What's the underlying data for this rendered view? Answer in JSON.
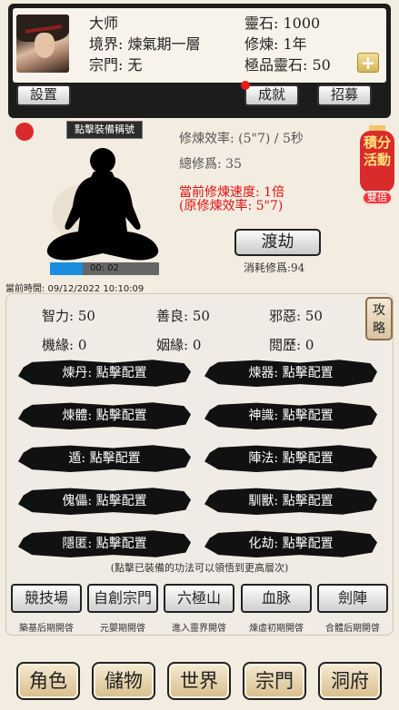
{
  "player": {
    "name": "大师",
    "realm_label": "境界:",
    "realm": "煉氣期一層",
    "sect_label": "宗門:",
    "sect": "无",
    "spirit_stone_label": "靈石:",
    "spirit_stone": "1000",
    "cultivation_label": "修煉:",
    "cultivation_time": "1年",
    "premium_stone_label": "極品靈石:",
    "premium_stone": "50"
  },
  "header_buttons": {
    "settings": "設置",
    "achievements": "成就",
    "recruit": "招募",
    "plus": "+"
  },
  "cultivation": {
    "equip_label": "點擊裝備稱號",
    "efficiency": "修煉效率:  (5\"7) / 5秒",
    "total": "總修爲:  35",
    "current_speed": "當前修煉速度:  1倍",
    "original_efficiency": "(原修煉效率:  5\"7)",
    "progress_text": "00:  02",
    "progress_fraction": 0.3,
    "dujie_button": "渡劫",
    "consume": "消耗修爲:94",
    "current_time": "當前時間:  09/12/2022  10:10:09"
  },
  "event": {
    "lantern_text": "積分\n活動",
    "tag": "雙倍"
  },
  "attributes": {
    "row1": [
      {
        "label": "智力:",
        "value": "50"
      },
      {
        "label": "善良:",
        "value": "50"
      },
      {
        "label": "邪惡:",
        "value": "50"
      }
    ],
    "row2": [
      {
        "label": "機緣:",
        "value": "0"
      },
      {
        "label": "姻緣:",
        "value": "0"
      },
      {
        "label": "閲歷:",
        "value": "0"
      }
    ],
    "guide": "攻\n略"
  },
  "skills": [
    "煉丹:  點擊配置",
    "煉器:  點擊配置",
    "煉體:  點擊配置",
    "神識:  點擊配置",
    "遁:  點擊配置",
    "陣法:  點擊配置",
    "傀儡:  點擊配置",
    "馴獸:  點擊配置",
    "隱匿:  點擊配置",
    "化劫:  點擊配置"
  ],
  "skills_hint": "(點擊已裝備的功法可以領悟到更高層次)",
  "features": [
    {
      "label": "競技場",
      "sub": "築基后期開啓"
    },
    {
      "label": "自創宗門",
      "sub": "元嬰期開啓"
    },
    {
      "label": "六極山",
      "sub": "進入靈界開啓"
    },
    {
      "label": "血脉",
      "sub": "煉虛初期開啓"
    },
    {
      "label": "劍陣",
      "sub": "合體后期開啓"
    }
  ],
  "nav": [
    "角色",
    "儲物",
    "世界",
    "宗門",
    "洞府"
  ],
  "colors": {
    "accent_red": "#e01010",
    "progress_blue": "#1a8fe0",
    "lantern_red": "#d92b2b"
  }
}
